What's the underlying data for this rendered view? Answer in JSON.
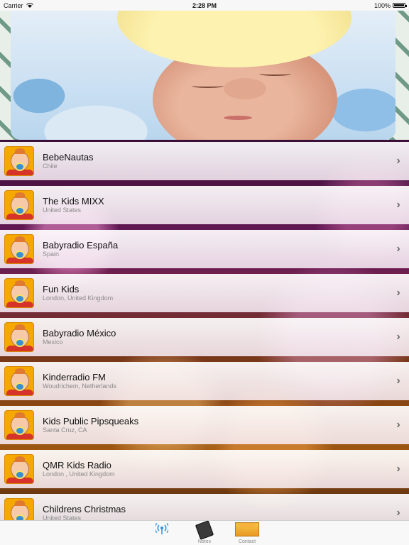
{
  "status_bar": {
    "carrier": "Carrier",
    "time": "2:28 PM",
    "battery": "100%"
  },
  "stations": [
    {
      "name": "BebeNautas",
      "location": "Chile"
    },
    {
      "name": "The Kids MIXX",
      "location": "United States"
    },
    {
      "name": "Babyradio España",
      "location": "Spain"
    },
    {
      "name": "Fun Kids",
      "location": "London, United Kingdom"
    },
    {
      "name": "Babyradio México",
      "location": "Mexico"
    },
    {
      "name": "Kinderradio FM",
      "location": "Woudrichem, Netherlands"
    },
    {
      "name": "Kids Public Pipsqueaks",
      "location": "Santa Cruz, CA"
    },
    {
      "name": "QMR Kids Radio",
      "location": "London , United Kingdom"
    },
    {
      "name": "Childrens Christmas",
      "location": "United States"
    }
  ],
  "tabbar": {
    "radio_label": "",
    "notes_label": "Notes",
    "contact_label": "Contact"
  }
}
